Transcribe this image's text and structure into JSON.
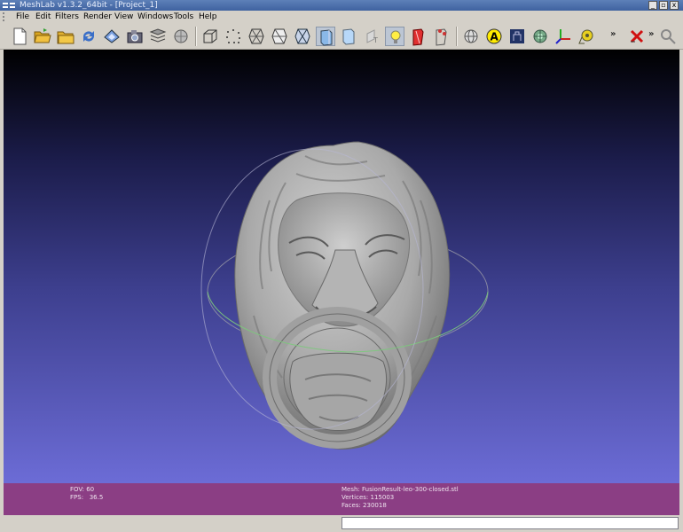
{
  "window": {
    "title": "MeshLab v1.3.2_64bit - [Project_1]",
    "controls": [
      "_",
      "▫",
      "x"
    ]
  },
  "menu": [
    "File",
    "Edit",
    "Filters",
    "Render",
    "View",
    "Windows",
    "Tools",
    "Help"
  ],
  "toolbar": {
    "overflow_label": "»"
  },
  "info": {
    "fov": "FOV: 60",
    "fps": "FPS:   36.5",
    "mesh": "Mesh: FusionResult-leo-300-closed.stl",
    "vertices": "Vertices: 115003",
    "faces": "Faces: 230018"
  },
  "colors": {
    "viewport_top": "#000000",
    "viewport_bottom": "#6c6cd6",
    "infobar": "#8b3e84",
    "chrome": "#d4d0c8"
  }
}
